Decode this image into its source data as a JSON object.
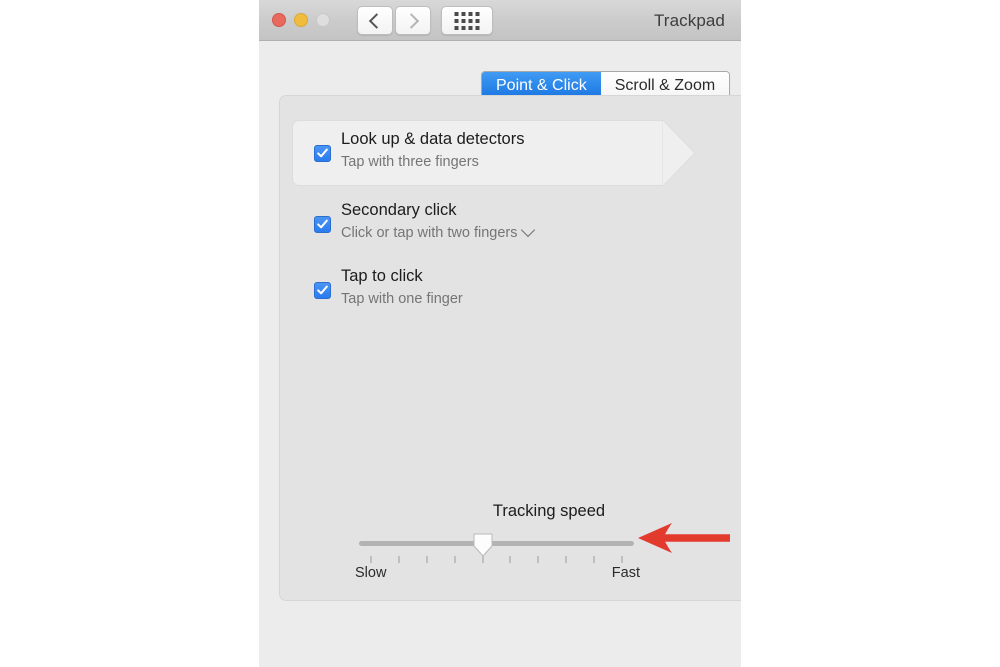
{
  "window": {
    "title": "Trackpad",
    "traffic_lights": [
      {
        "name": "close",
        "color": "#e8695e"
      },
      {
        "name": "minimize",
        "color": "#f1bb3e"
      },
      {
        "name": "zoom",
        "color": "#dedede"
      }
    ],
    "toolbar": {
      "back_icon": "chevron-left-icon",
      "forward_icon": "chevron-right-icon",
      "grid_icon": "show-all-grid-icon"
    }
  },
  "tabs": [
    {
      "label": "Point & Click",
      "selected": true
    },
    {
      "label": "Scroll & Zoom",
      "selected": false
    }
  ],
  "options": [
    {
      "title": "Look up & data detectors",
      "subtitle": "Tap with three fingers",
      "checked": true,
      "highlighted": true,
      "has_dropdown": false
    },
    {
      "title": "Secondary click",
      "subtitle": "Click or tap with two fingers",
      "checked": true,
      "highlighted": false,
      "has_dropdown": true
    },
    {
      "title": "Tap to click",
      "subtitle": "Tap with one finger",
      "checked": true,
      "highlighted": false,
      "has_dropdown": false
    }
  ],
  "tracking_speed": {
    "label": "Tracking speed",
    "min_label": "Slow",
    "max_label": "Fast",
    "tick_count": 10,
    "value_index": 4,
    "value_percent": 45
  },
  "annotation": {
    "arrow_color": "#e23b2e",
    "direction": "left",
    "points_at": "tracking-speed-slider"
  },
  "colors": {
    "accent_blue": "#1874e0",
    "checkbox_blue": "#2a7bef",
    "window_bg": "#ececec",
    "panel_bg": "#e3e3e3",
    "titlebar_bg": "#cbcbcb"
  }
}
